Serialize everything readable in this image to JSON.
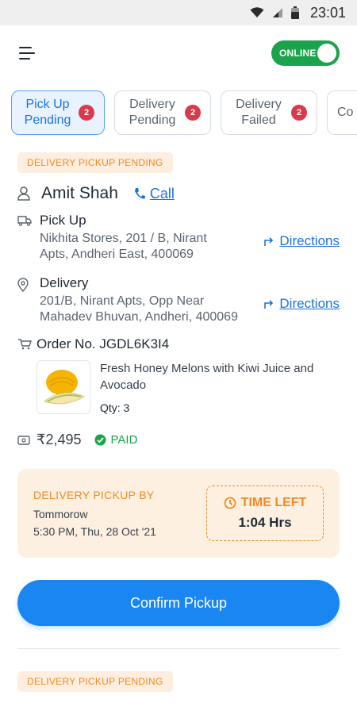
{
  "status_bar": {
    "time": "23:01"
  },
  "header": {
    "online_label": "ONLINE"
  },
  "tabs": [
    {
      "label": "Pick Up Pending",
      "badge": "2"
    },
    {
      "label": "Delivery Pending",
      "badge": "2"
    },
    {
      "label": "Delivery Failed",
      "badge": "2"
    },
    {
      "label": "Co"
    }
  ],
  "order": {
    "status_tag": "DELIVERY PICKUP PENDING",
    "customer_name": "Amit Shah",
    "call_label": "Call",
    "pickup": {
      "title": "Pick Up",
      "address": "Nikhita Stores, 201 / B, Nirant Apts, Andheri East, 400069",
      "directions_label": "Directions"
    },
    "delivery": {
      "title": "Delivery",
      "address": "201/B, Nirant Apts, Opp Near Mahadev Bhuvan, Andheri, 400069",
      "directions_label": "Directions"
    },
    "order_no": "Order No. JGDL6K3I4",
    "product": {
      "name": "Fresh Honey Melons with Kiwi Juice and Avocado",
      "qty": "Qty: 3"
    },
    "price": "₹2,495",
    "payment_status": "PAID",
    "pickup_by": {
      "title": "DELIVERY PICKUP BY",
      "day": "Tommorow",
      "time": "5:30 PM, Thu, 28 Oct '21"
    },
    "time_left": {
      "label": "TIME LEFT",
      "value": "1:04 Hrs"
    },
    "confirm_label": "Confirm Pickup"
  },
  "next_order": {
    "status_tag": "DELIVERY PICKUP PENDING"
  },
  "colors": {
    "accent": "#1a86f2",
    "online": "#1aa34a",
    "warning": "#f08a24",
    "badge": "#d93a4b"
  }
}
